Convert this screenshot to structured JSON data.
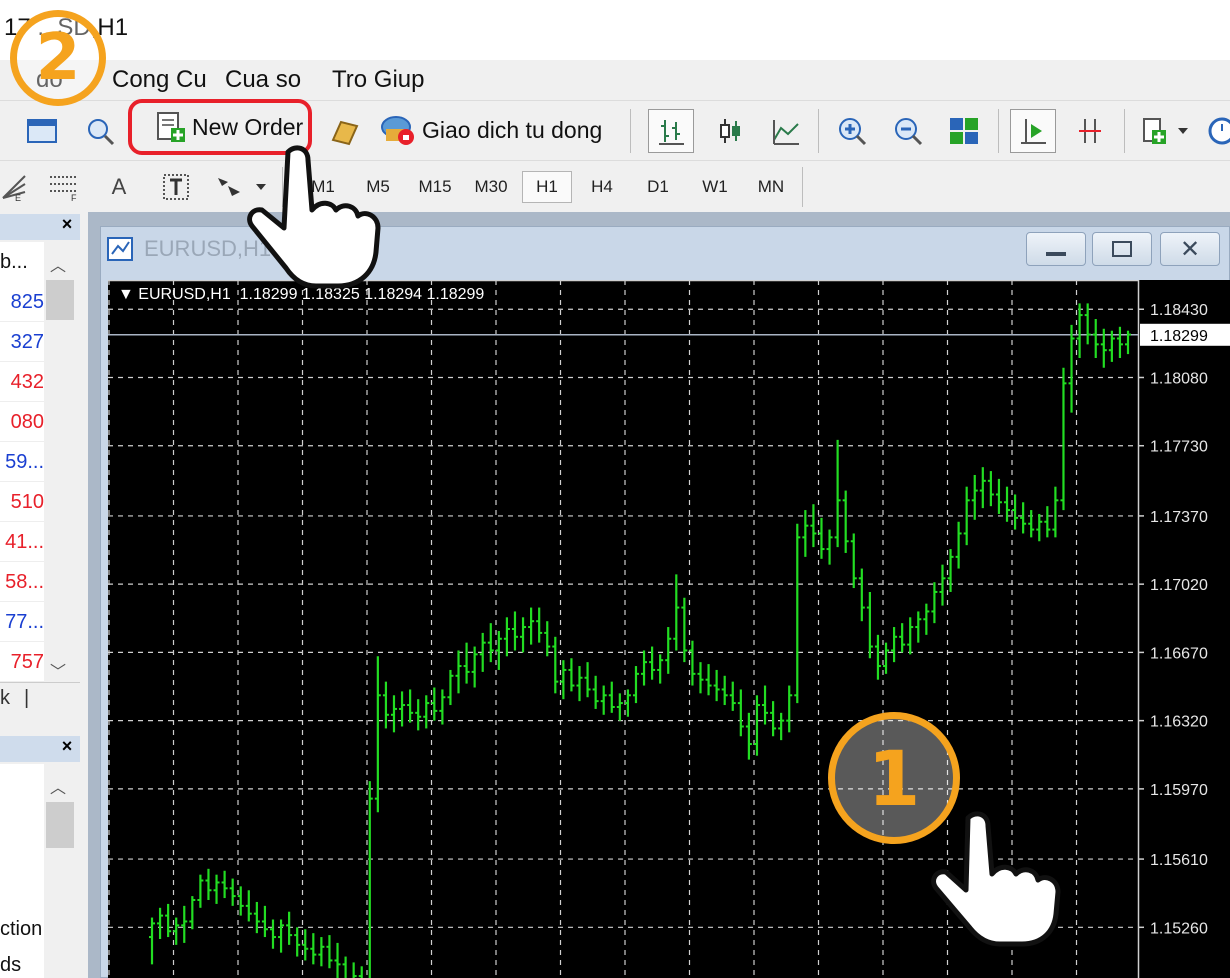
{
  "window": {
    "title": "17 ...SD,H1"
  },
  "menu": [
    {
      "label": "do"
    },
    {
      "label": "Cong Cu"
    },
    {
      "label": "Cua so"
    },
    {
      "label": "Tro Giup"
    }
  ],
  "toolbar": {
    "new_order_label": "New Order",
    "auto_trade_label": "Giao dich tu dong"
  },
  "toolbar2": {
    "text_tool": "A",
    "timeframes": [
      "M1",
      "M5",
      "M15",
      "M30",
      "H1",
      "H4",
      "D1",
      "W1",
      "MN"
    ],
    "active_timeframe": "H1"
  },
  "market_watch": {
    "header": "b...",
    "rows": [
      {
        "value": "825",
        "color": "#1a3fd1"
      },
      {
        "value": "327",
        "color": "#1a3fd1"
      },
      {
        "value": "432",
        "color": "#e8202a"
      },
      {
        "value": "080",
        "color": "#e8202a"
      },
      {
        "value": "59...",
        "color": "#1a3fd1"
      },
      {
        "value": "510",
        "color": "#e8202a"
      },
      {
        "value": "41...",
        "color": "#e8202a"
      },
      {
        "value": "58...",
        "color": "#e8202a"
      },
      {
        "value": "77...",
        "color": "#1a3fd1"
      },
      {
        "value": "757",
        "color": "#e8202a"
      }
    ]
  },
  "navigator": {
    "items": [
      "ction",
      "ds"
    ]
  },
  "chart_window": {
    "tab_title": "EURUSD,H1",
    "header": "EURUSD,H1  1.18299 1.18325 1.18294 1.18299",
    "price_labels": [
      "1.18430",
      "1.18080",
      "1.17730",
      "1.17370",
      "1.17020",
      "1.16670",
      "1.16320",
      "1.15970",
      "1.15610",
      "1.15260"
    ],
    "current_price": "1.18299"
  },
  "annotations": {
    "step1": "1",
    "step2": "2",
    "accent_color": "#f5a31e",
    "highlight_color": "#e8202a"
  },
  "chart_data": {
    "type": "bar",
    "symbol": "EURUSD",
    "timeframe": "H1",
    "bar_color": "#22dd22",
    "ylim": [
      1.15,
      1.1858
    ],
    "y_ticks": [
      1.1843,
      1.1808,
      1.1773,
      1.1737,
      1.1702,
      1.1667,
      1.1632,
      1.1597,
      1.1561,
      1.1526
    ],
    "current_price": 1.18299,
    "ohlc": [
      [
        1.1521,
        1.1531,
        1.1507,
        1.1528
      ],
      [
        1.1528,
        1.1536,
        1.152,
        1.1532
      ],
      [
        1.1532,
        1.1538,
        1.1521,
        1.1524
      ],
      [
        1.1524,
        1.1531,
        1.1517,
        1.1527
      ],
      [
        1.1527,
        1.1537,
        1.1518,
        1.1529
      ],
      [
        1.1529,
        1.1542,
        1.1525,
        1.154
      ],
      [
        1.154,
        1.1553,
        1.1536,
        1.155
      ],
      [
        1.155,
        1.1556,
        1.154,
        1.1545
      ],
      [
        1.1545,
        1.1553,
        1.1538,
        1.1549
      ],
      [
        1.1549,
        1.1555,
        1.1541,
        1.1546
      ],
      [
        1.1546,
        1.1551,
        1.1537,
        1.1542
      ],
      [
        1.1542,
        1.1547,
        1.1532,
        1.1537
      ],
      [
        1.1537,
        1.1545,
        1.1529,
        1.1533
      ],
      [
        1.1533,
        1.1539,
        1.1523,
        1.1529
      ],
      [
        1.1529,
        1.1537,
        1.1521,
        1.1525
      ],
      [
        1.1525,
        1.153,
        1.1515,
        1.1521
      ],
      [
        1.1521,
        1.153,
        1.1513,
        1.1527
      ],
      [
        1.1527,
        1.1534,
        1.1517,
        1.1522
      ],
      [
        1.1522,
        1.1526,
        1.1511,
        1.1517
      ],
      [
        1.1517,
        1.1525,
        1.1509,
        1.1515
      ],
      [
        1.1515,
        1.1523,
        1.1507,
        1.1512
      ],
      [
        1.1512,
        1.1521,
        1.1506,
        1.1516
      ],
      [
        1.1516,
        1.1522,
        1.1505,
        1.1509
      ],
      [
        1.1509,
        1.1518,
        1.15,
        1.1507
      ],
      [
        1.1507,
        1.1511,
        1.1494,
        1.1498
      ],
      [
        1.1498,
        1.1508,
        1.1491,
        1.1501
      ],
      [
        1.1501,
        1.1506,
        1.1488,
        1.1495
      ],
      [
        1.1495,
        1.1601,
        1.1491,
        1.1592
      ],
      [
        1.1592,
        1.1665,
        1.1585,
        1.1645
      ],
      [
        1.1645,
        1.1652,
        1.1628,
        1.1635
      ],
      [
        1.1635,
        1.1645,
        1.1626,
        1.1638
      ],
      [
        1.1638,
        1.1647,
        1.1629,
        1.164
      ],
      [
        1.164,
        1.1648,
        1.1631,
        1.1636
      ],
      [
        1.1636,
        1.1643,
        1.1627,
        1.1634
      ],
      [
        1.1634,
        1.1645,
        1.1628,
        1.1641
      ],
      [
        1.1641,
        1.1649,
        1.1632,
        1.1637
      ],
      [
        1.1637,
        1.1648,
        1.163,
        1.1644
      ],
      [
        1.1644,
        1.1658,
        1.164,
        1.1655
      ],
      [
        1.1655,
        1.1668,
        1.1646,
        1.166
      ],
      [
        1.166,
        1.1672,
        1.1651,
        1.1657
      ],
      [
        1.1657,
        1.167,
        1.1649,
        1.1666
      ],
      [
        1.1666,
        1.1677,
        1.1657,
        1.1672
      ],
      [
        1.1672,
        1.1682,
        1.1662,
        1.1668
      ],
      [
        1.1668,
        1.1678,
        1.1658,
        1.1674
      ],
      [
        1.1674,
        1.1685,
        1.1665,
        1.1679
      ],
      [
        1.1679,
        1.1688,
        1.1668,
        1.1675
      ],
      [
        1.1675,
        1.1685,
        1.1667,
        1.168
      ],
      [
        1.168,
        1.169,
        1.1671,
        1.1683
      ],
      [
        1.1683,
        1.169,
        1.1672,
        1.1677
      ],
      [
        1.1677,
        1.1683,
        1.1665,
        1.167
      ],
      [
        1.167,
        1.1675,
        1.1646,
        1.1652
      ],
      [
        1.1652,
        1.1663,
        1.1643,
        1.1658
      ],
      [
        1.1658,
        1.1664,
        1.1647,
        1.165
      ],
      [
        1.165,
        1.166,
        1.1642,
        1.1654
      ],
      [
        1.1654,
        1.1662,
        1.1644,
        1.1648
      ],
      [
        1.1648,
        1.1655,
        1.1638,
        1.1642
      ],
      [
        1.1642,
        1.165,
        1.1635,
        1.1645
      ],
      [
        1.1645,
        1.1652,
        1.1636,
        1.1639
      ],
      [
        1.1639,
        1.1646,
        1.1632,
        1.1641
      ],
      [
        1.1641,
        1.1648,
        1.1634,
        1.1645
      ],
      [
        1.1645,
        1.166,
        1.1641,
        1.1656
      ],
      [
        1.1656,
        1.1668,
        1.165,
        1.1662
      ],
      [
        1.1662,
        1.167,
        1.1653,
        1.1658
      ],
      [
        1.1658,
        1.1666,
        1.1651,
        1.1663
      ],
      [
        1.1663,
        1.168,
        1.1656,
        1.1674
      ],
      [
        1.1674,
        1.1707,
        1.1668,
        1.169
      ],
      [
        1.169,
        1.1695,
        1.1662,
        1.1668
      ],
      [
        1.1668,
        1.1673,
        1.165,
        1.1656
      ],
      [
        1.1656,
        1.1662,
        1.1646,
        1.1653
      ],
      [
        1.1653,
        1.1661,
        1.1645,
        1.165
      ],
      [
        1.165,
        1.1658,
        1.1642,
        1.1648
      ],
      [
        1.1648,
        1.1655,
        1.164,
        1.1645
      ],
      [
        1.1645,
        1.1652,
        1.1637,
        1.1641
      ],
      [
        1.1641,
        1.1648,
        1.1624,
        1.1629
      ],
      [
        1.1629,
        1.1636,
        1.1612,
        1.162
      ],
      [
        1.162,
        1.1645,
        1.1614,
        1.164
      ],
      [
        1.164,
        1.165,
        1.163,
        1.1636
      ],
      [
        1.1636,
        1.1642,
        1.1624,
        1.1628
      ],
      [
        1.1628,
        1.1636,
        1.1622,
        1.1632
      ],
      [
        1.1632,
        1.165,
        1.1626,
        1.1645
      ],
      [
        1.1645,
        1.1733,
        1.1641,
        1.1726
      ],
      [
        1.1726,
        1.174,
        1.1716,
        1.1732
      ],
      [
        1.1732,
        1.1743,
        1.1721,
        1.1728
      ],
      [
        1.1728,
        1.1736,
        1.1715,
        1.172
      ],
      [
        1.172,
        1.173,
        1.1712,
        1.1726
      ],
      [
        1.1726,
        1.1776,
        1.1721,
        1.1745
      ],
      [
        1.1745,
        1.175,
        1.1718,
        1.1724
      ],
      [
        1.1724,
        1.1728,
        1.17,
        1.1705
      ],
      [
        1.1705,
        1.171,
        1.1683,
        1.169
      ],
      [
        1.169,
        1.1698,
        1.1664,
        1.167
      ],
      [
        1.167,
        1.1676,
        1.1653,
        1.166
      ],
      [
        1.166,
        1.1672,
        1.1656,
        1.1668
      ],
      [
        1.1668,
        1.168,
        1.1662,
        1.1675
      ],
      [
        1.1675,
        1.1682,
        1.1667,
        1.1671
      ],
      [
        1.1671,
        1.1685,
        1.1666,
        1.168
      ],
      [
        1.168,
        1.1688,
        1.1672,
        1.1684
      ],
      [
        1.1684,
        1.1692,
        1.1676,
        1.1688
      ],
      [
        1.1688,
        1.1703,
        1.1682,
        1.1698
      ],
      [
        1.1698,
        1.1712,
        1.1691,
        1.1705
      ],
      [
        1.1705,
        1.172,
        1.1698,
        1.1716
      ],
      [
        1.1716,
        1.1734,
        1.171,
        1.1728
      ],
      [
        1.1728,
        1.1752,
        1.1722,
        1.1745
      ],
      [
        1.1745,
        1.1758,
        1.1735,
        1.175
      ],
      [
        1.175,
        1.1762,
        1.1741,
        1.1755
      ],
      [
        1.1755,
        1.176,
        1.1742,
        1.1748
      ],
      [
        1.1748,
        1.1756,
        1.1738,
        1.1744
      ],
      [
        1.1744,
        1.1752,
        1.1734,
        1.174
      ],
      [
        1.174,
        1.1748,
        1.173,
        1.1736
      ],
      [
        1.1736,
        1.1744,
        1.1728,
        1.1733
      ],
      [
        1.1733,
        1.174,
        1.1726,
        1.173
      ],
      [
        1.173,
        1.1738,
        1.1724,
        1.1734
      ],
      [
        1.1734,
        1.1742,
        1.1726,
        1.173
      ],
      [
        1.173,
        1.1752,
        1.1726,
        1.1745
      ],
      [
        1.1745,
        1.1813,
        1.174,
        1.1805
      ],
      [
        1.1805,
        1.1835,
        1.179,
        1.1828
      ],
      [
        1.1828,
        1.1846,
        1.1818,
        1.184
      ],
      [
        1.184,
        1.1846,
        1.1825,
        1.183
      ],
      [
        1.183,
        1.1838,
        1.1818,
        1.1825
      ],
      [
        1.1825,
        1.1833,
        1.1813,
        1.1822
      ],
      [
        1.1822,
        1.1832,
        1.1816,
        1.1828
      ],
      [
        1.1828,
        1.1834,
        1.1818,
        1.1825
      ],
      [
        1.1825,
        1.1832,
        1.182,
        1.183
      ]
    ]
  }
}
